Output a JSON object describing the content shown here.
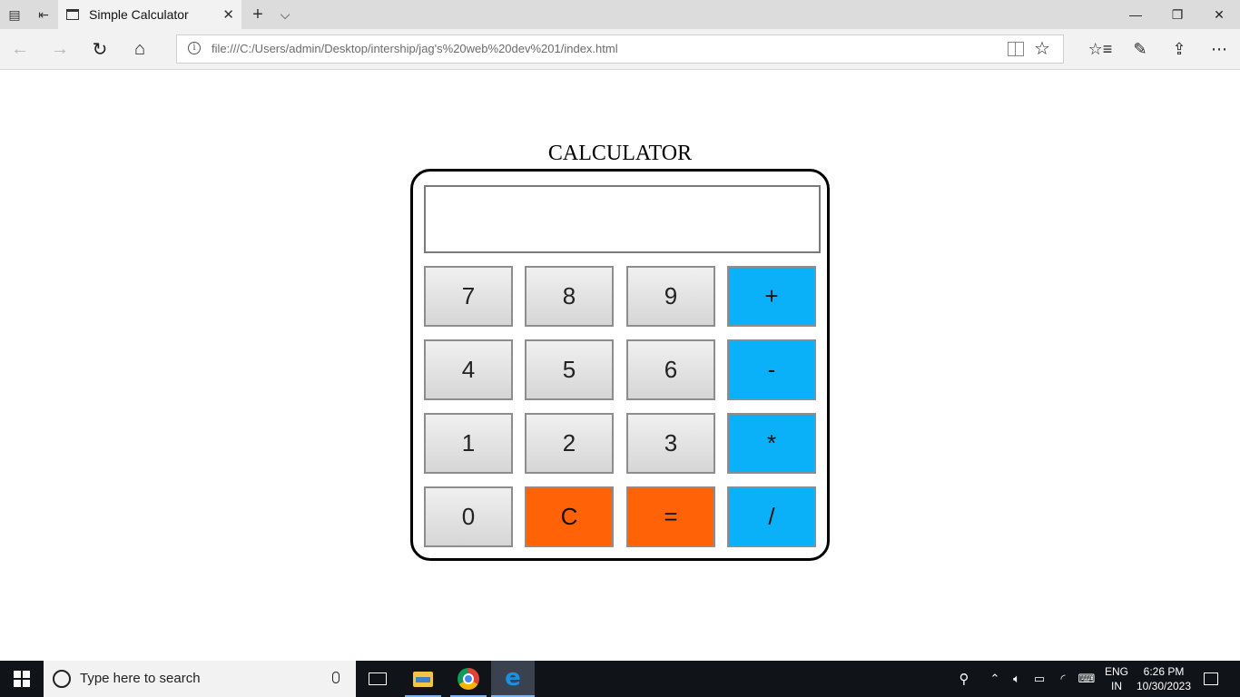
{
  "browser": {
    "tab": {
      "title": "Simple Calculator"
    },
    "new_tab_symbol": "+",
    "tab_list_symbol": "⌵",
    "address": {
      "url": "file:///C:/Users/admin/Desktop/intership/jag's%20web%20dev%201/index.html"
    },
    "icons": {
      "back": "←",
      "forward": "→",
      "refresh": "↻",
      "home": "⌂",
      "favorite": "☆",
      "favorites_list": "☆≡",
      "notes": "✎",
      "share": "⇪",
      "more": "⋯",
      "minimize": "—",
      "restore": "❐",
      "close": "✕"
    }
  },
  "calculator": {
    "title": "CALCULATOR",
    "display_value": "",
    "keys": {
      "k7": "7",
      "k8": "8",
      "k9": "9",
      "plus": "+",
      "k4": "4",
      "k5": "5",
      "k6": "6",
      "minus": "-",
      "k1": "1",
      "k2": "2",
      "k3": "3",
      "times": "*",
      "k0": "0",
      "clear": "C",
      "equals": "=",
      "divide": "/"
    },
    "colors": {
      "operator": "#0ab0f8",
      "action": "#ff6207",
      "digit": "#e0e0e0"
    }
  },
  "taskbar": {
    "search_placeholder": "Type here to search",
    "language": "ENG",
    "region": "IN",
    "time": "6:26 PM",
    "date": "10/30/2023"
  }
}
